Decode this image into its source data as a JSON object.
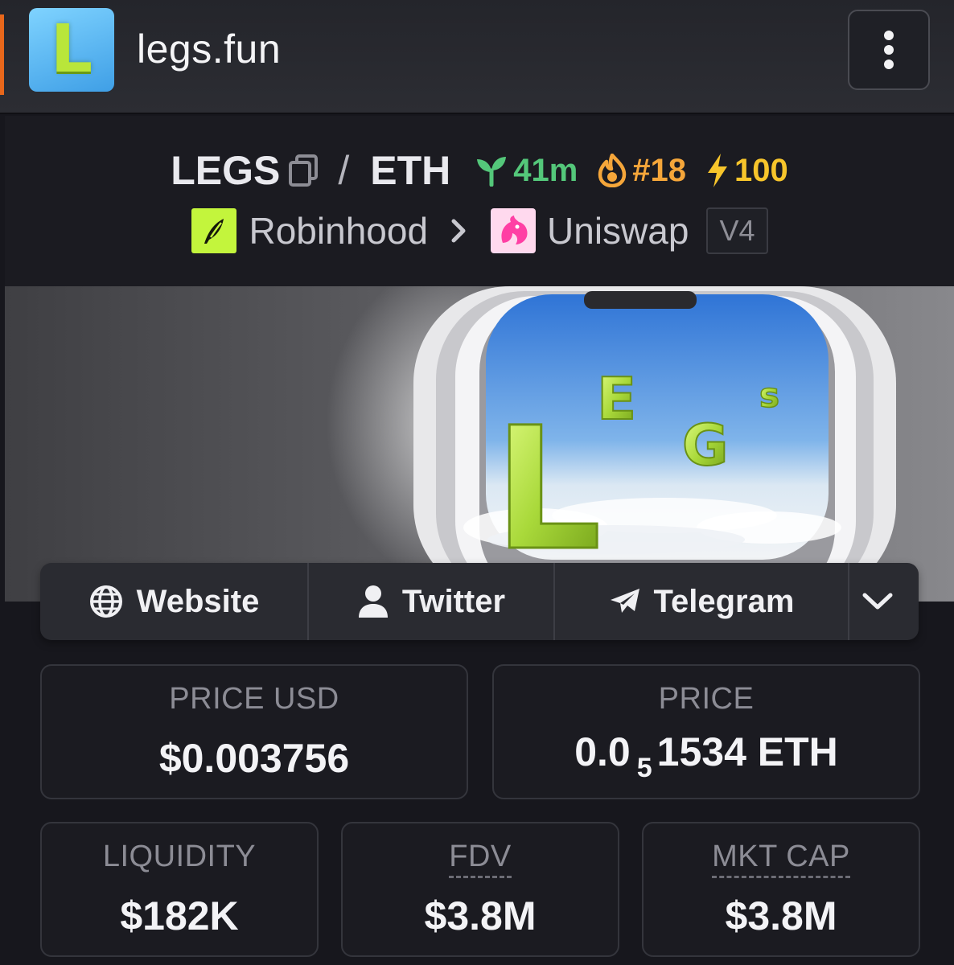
{
  "header": {
    "app_logo_letter": "L",
    "title": "legs.fun",
    "menu_icon": "vertical-dots-icon"
  },
  "pair": {
    "base": "LEGS",
    "separator": "/",
    "quote": "ETH",
    "age": "41m",
    "rank": "#18",
    "boost": "100",
    "chain": "Robinhood",
    "dex": "Uniswap",
    "version": "V4"
  },
  "banner": {
    "letters": [
      "L",
      "E",
      "G",
      "s"
    ]
  },
  "links": {
    "website": "Website",
    "twitter": "Twitter",
    "telegram": "Telegram",
    "more_icon": "chevron-down-icon"
  },
  "stats": {
    "price_usd_label": "PRICE USD",
    "price_usd_value": "$0.003756",
    "price_label": "PRICE",
    "price_prefix": "0.0",
    "price_zero_count": "5",
    "price_digits": "1534 ETH",
    "liquidity_label": "LIQUIDITY",
    "liquidity_value": "$182K",
    "fdv_label": "FDV",
    "fdv_value": "$3.8M",
    "mktcap_label": "MKT CAP",
    "mktcap_value": "$3.8M"
  },
  "colors": {
    "accent": "#e8671b",
    "age_green": "#54c77a",
    "rank_orange": "#f5a63a",
    "boost_yellow": "#f7c52b",
    "robinhood_lime": "#c3f53c",
    "uniswap_pink": "#ff3fa4"
  }
}
